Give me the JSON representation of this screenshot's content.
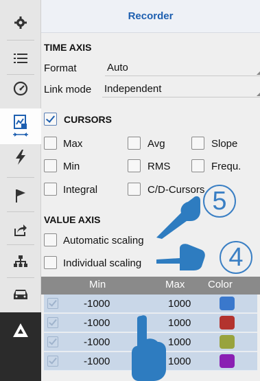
{
  "sidebar": {
    "items": [
      {
        "icon": "gear-icon"
      },
      {
        "icon": "list-icon"
      },
      {
        "icon": "gauge-icon"
      },
      {
        "icon": "recorder-icon",
        "active": true
      },
      {
        "icon": "lightning-icon"
      },
      {
        "icon": "flag-icon"
      },
      {
        "icon": "share-icon"
      },
      {
        "icon": "network-icon"
      },
      {
        "icon": "car-icon"
      },
      {
        "icon": "triangle-logo-icon"
      }
    ]
  },
  "panel": {
    "title": "Recorder",
    "time_axis": {
      "heading": "TIME AXIS",
      "format_label": "Format",
      "format_value": "Auto",
      "link_label": "Link mode",
      "link_value": "Independent"
    },
    "cursors": {
      "heading": "CURSORS",
      "checked": true,
      "options": [
        {
          "label": "Max",
          "checked": false
        },
        {
          "label": "Avg",
          "checked": false
        },
        {
          "label": "Slope",
          "checked": false
        },
        {
          "label": "Min",
          "checked": false
        },
        {
          "label": "RMS",
          "checked": false
        },
        {
          "label": "Frequ.",
          "checked": false
        },
        {
          "label": "Integral",
          "checked": false
        },
        {
          "label": "C/D-Cursors",
          "checked": false
        }
      ]
    },
    "value_axis": {
      "heading": "VALUE AXIS",
      "automatic_label": "Automatic scaling",
      "individual_label": "Individual scaling"
    },
    "table": {
      "headers": {
        "min": "Min",
        "max": "Max",
        "color": "Color"
      },
      "rows": [
        {
          "min": "-1000",
          "max": "1000",
          "color": "#3a78cc"
        },
        {
          "min": "-1000",
          "max": "1000",
          "color": "#b3332e"
        },
        {
          "min": "-1000",
          "max": "1000",
          "color": "#98a33e"
        },
        {
          "min": "-1000",
          "max": "1000",
          "color": "#8a1fb3"
        }
      ]
    }
  },
  "annotations": {
    "badge_5": "5",
    "badge_4": "4"
  }
}
